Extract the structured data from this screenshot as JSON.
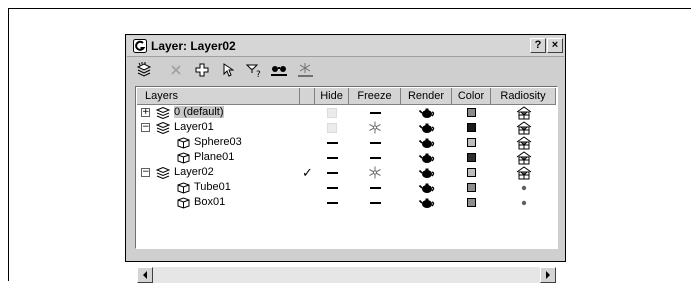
{
  "window": {
    "title": "Layer: Layer02",
    "help_label": "?",
    "close_label": "×"
  },
  "toolbar": {
    "tools": [
      {
        "icon": "create-layer-icon"
      },
      {
        "icon": "delete-layer-icon"
      },
      {
        "icon": "add-to-layer-icon"
      },
      {
        "icon": "select-objects-icon"
      },
      {
        "icon": "highlight-layer-icon"
      },
      {
        "icon": "hide-all-icon"
      },
      {
        "icon": "freeze-all-icon"
      }
    ]
  },
  "columns": {
    "layers": "Layers",
    "hide": "Hide",
    "freeze": "Freeze",
    "render": "Render",
    "color": "Color",
    "radiosity": "Radiosity"
  },
  "rows": [
    {
      "name": "0 (default)",
      "level": 0,
      "expander": "+",
      "type": "layer",
      "active": false,
      "hide": "disabled",
      "freeze": "dash",
      "render": "teapot",
      "color": "#8a8a8a",
      "radiosity": "house",
      "selected": true
    },
    {
      "name": "Layer01",
      "level": 0,
      "expander": "−",
      "type": "layer",
      "active": false,
      "hide": "disabled",
      "freeze": "snowflake",
      "render": "teapot",
      "color": "#1a1a1a",
      "radiosity": "house",
      "selected": false
    },
    {
      "name": "Sphere03",
      "level": 1,
      "expander": "",
      "type": "object",
      "active": false,
      "hide": "dash",
      "freeze": "dash",
      "render": "teapot",
      "color": "#bdbdbd",
      "radiosity": "house",
      "selected": false
    },
    {
      "name": "Plane01",
      "level": 1,
      "expander": "",
      "type": "object",
      "active": false,
      "hide": "dash",
      "freeze": "dash",
      "render": "teapot",
      "color": "#2e2e2e",
      "radiosity": "house",
      "selected": false
    },
    {
      "name": "Layer02",
      "level": 0,
      "expander": "−",
      "type": "layer",
      "active": true,
      "hide": "dash",
      "freeze": "snowflake",
      "render": "teapot",
      "color": "#bdbdbd",
      "radiosity": "house",
      "selected": false
    },
    {
      "name": "Tube01",
      "level": 1,
      "expander": "",
      "type": "object",
      "active": false,
      "hide": "dash",
      "freeze": "dash",
      "render": "teapot",
      "color": "#8e8e8e",
      "radiosity": "dot",
      "selected": false
    },
    {
      "name": "Box01",
      "level": 1,
      "expander": "",
      "type": "object",
      "active": false,
      "hide": "dash",
      "freeze": "dash",
      "render": "teapot",
      "color": "#8e8e8e",
      "radiosity": "dot",
      "selected": false
    }
  ],
  "active_mark": "✓"
}
